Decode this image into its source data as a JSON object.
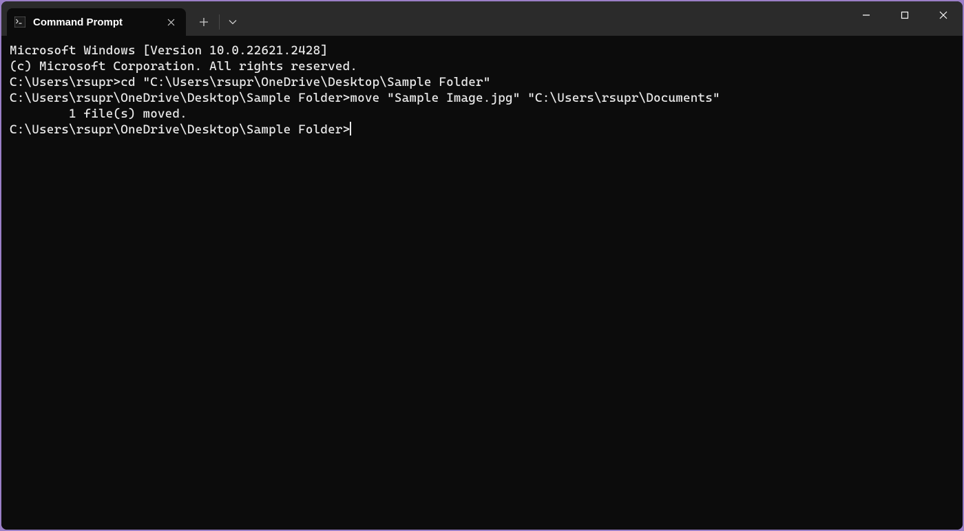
{
  "tab": {
    "title": "Command Prompt"
  },
  "terminal": {
    "lines": [
      "Microsoft Windows [Version 10.0.22621.2428]",
      "(c) Microsoft Corporation. All rights reserved.",
      "",
      "C:\\Users\\rsupr>cd \"C:\\Users\\rsupr\\OneDrive\\Desktop\\Sample Folder\"",
      "",
      "C:\\Users\\rsupr\\OneDrive\\Desktop\\Sample Folder>move \"Sample Image.jpg\" \"C:\\Users\\rsupr\\Documents\"",
      "        1 file(s) moved.",
      "",
      "C:\\Users\\rsupr\\OneDrive\\Desktop\\Sample Folder>"
    ]
  }
}
